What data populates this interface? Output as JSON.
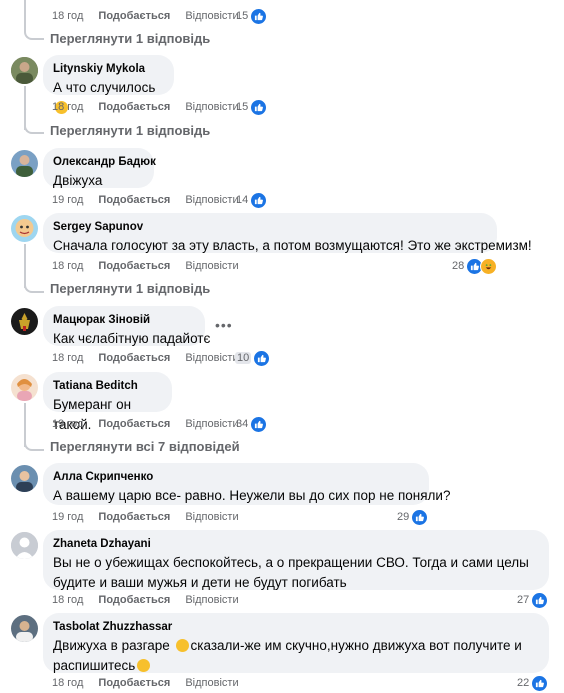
{
  "comments": [
    {
      "author": "",
      "text": "",
      "time": "18 год",
      "like": "Подобається",
      "reply": "Відповісти",
      "reactions": "15",
      "view_replies": "Переглянути 1 відповідь"
    },
    {
      "author": "Litynskiy Mykola",
      "text": "А что случилось",
      "time": "18 год",
      "like": "Подобається",
      "reply": "Відповісти",
      "reactions": "15",
      "view_replies": "Переглянути 1 відповідь"
    },
    {
      "author": "Олександр Бадюк",
      "text": "Двіжуха",
      "time": "19 год",
      "like": "Подобається",
      "reply": "Відповісти",
      "reactions": "14"
    },
    {
      "author": "Sergey Sapunov",
      "text": "Сначала голосуют за эту власть, а потом возмущаются! Это же экстремизм!",
      "time": "18 год",
      "like": "Подобається",
      "reply": "Відповісти",
      "reactions": "28",
      "view_replies": "Переглянути 1 відповідь"
    },
    {
      "author": "Мацюрак Зіновій",
      "text": "Как чєлабітную падайотє",
      "time": "18 год",
      "like": "Подобається",
      "reply": "Відповісти",
      "reactions": "10"
    },
    {
      "author": "Tatiana Beditch",
      "text": "Бумеранг он такой.",
      "time": "19 год",
      "like": "Подобається",
      "reply": "Відповісти",
      "reactions": "34",
      "view_replies": "Переглянути всі 7 відповідей"
    },
    {
      "author": "Алла Скрипченко",
      "text": "А вашему царю все- равно. Неужели вы до сих пор не поняли?",
      "time": "19 год",
      "like": "Подобається",
      "reply": "Відповісти",
      "reactions": "29"
    },
    {
      "author": "Zhaneta Dzhayani",
      "text": "Вы не о убежищах беспокойтесь, а о прекращении СВО. Тогда и сами целы будите и ваши мужья и дети не будут погибать",
      "time": "18 год",
      "like": "Подобається",
      "reply": "Відповісти",
      "reactions": "27"
    },
    {
      "author": "Tasbolat Zhuzzhassar",
      "text_a": "Движуха в разгаре",
      "text_b": "сказали-же им скучно,нужно движуха вот получите и распишитесь",
      "time": "18 год",
      "like": "Подобається",
      "reply": "Відповісти",
      "reactions": "22"
    }
  ],
  "colors": {
    "like_blue": "#1b74e4",
    "bubble": "#f0f2f5",
    "meta": "#65676b"
  }
}
